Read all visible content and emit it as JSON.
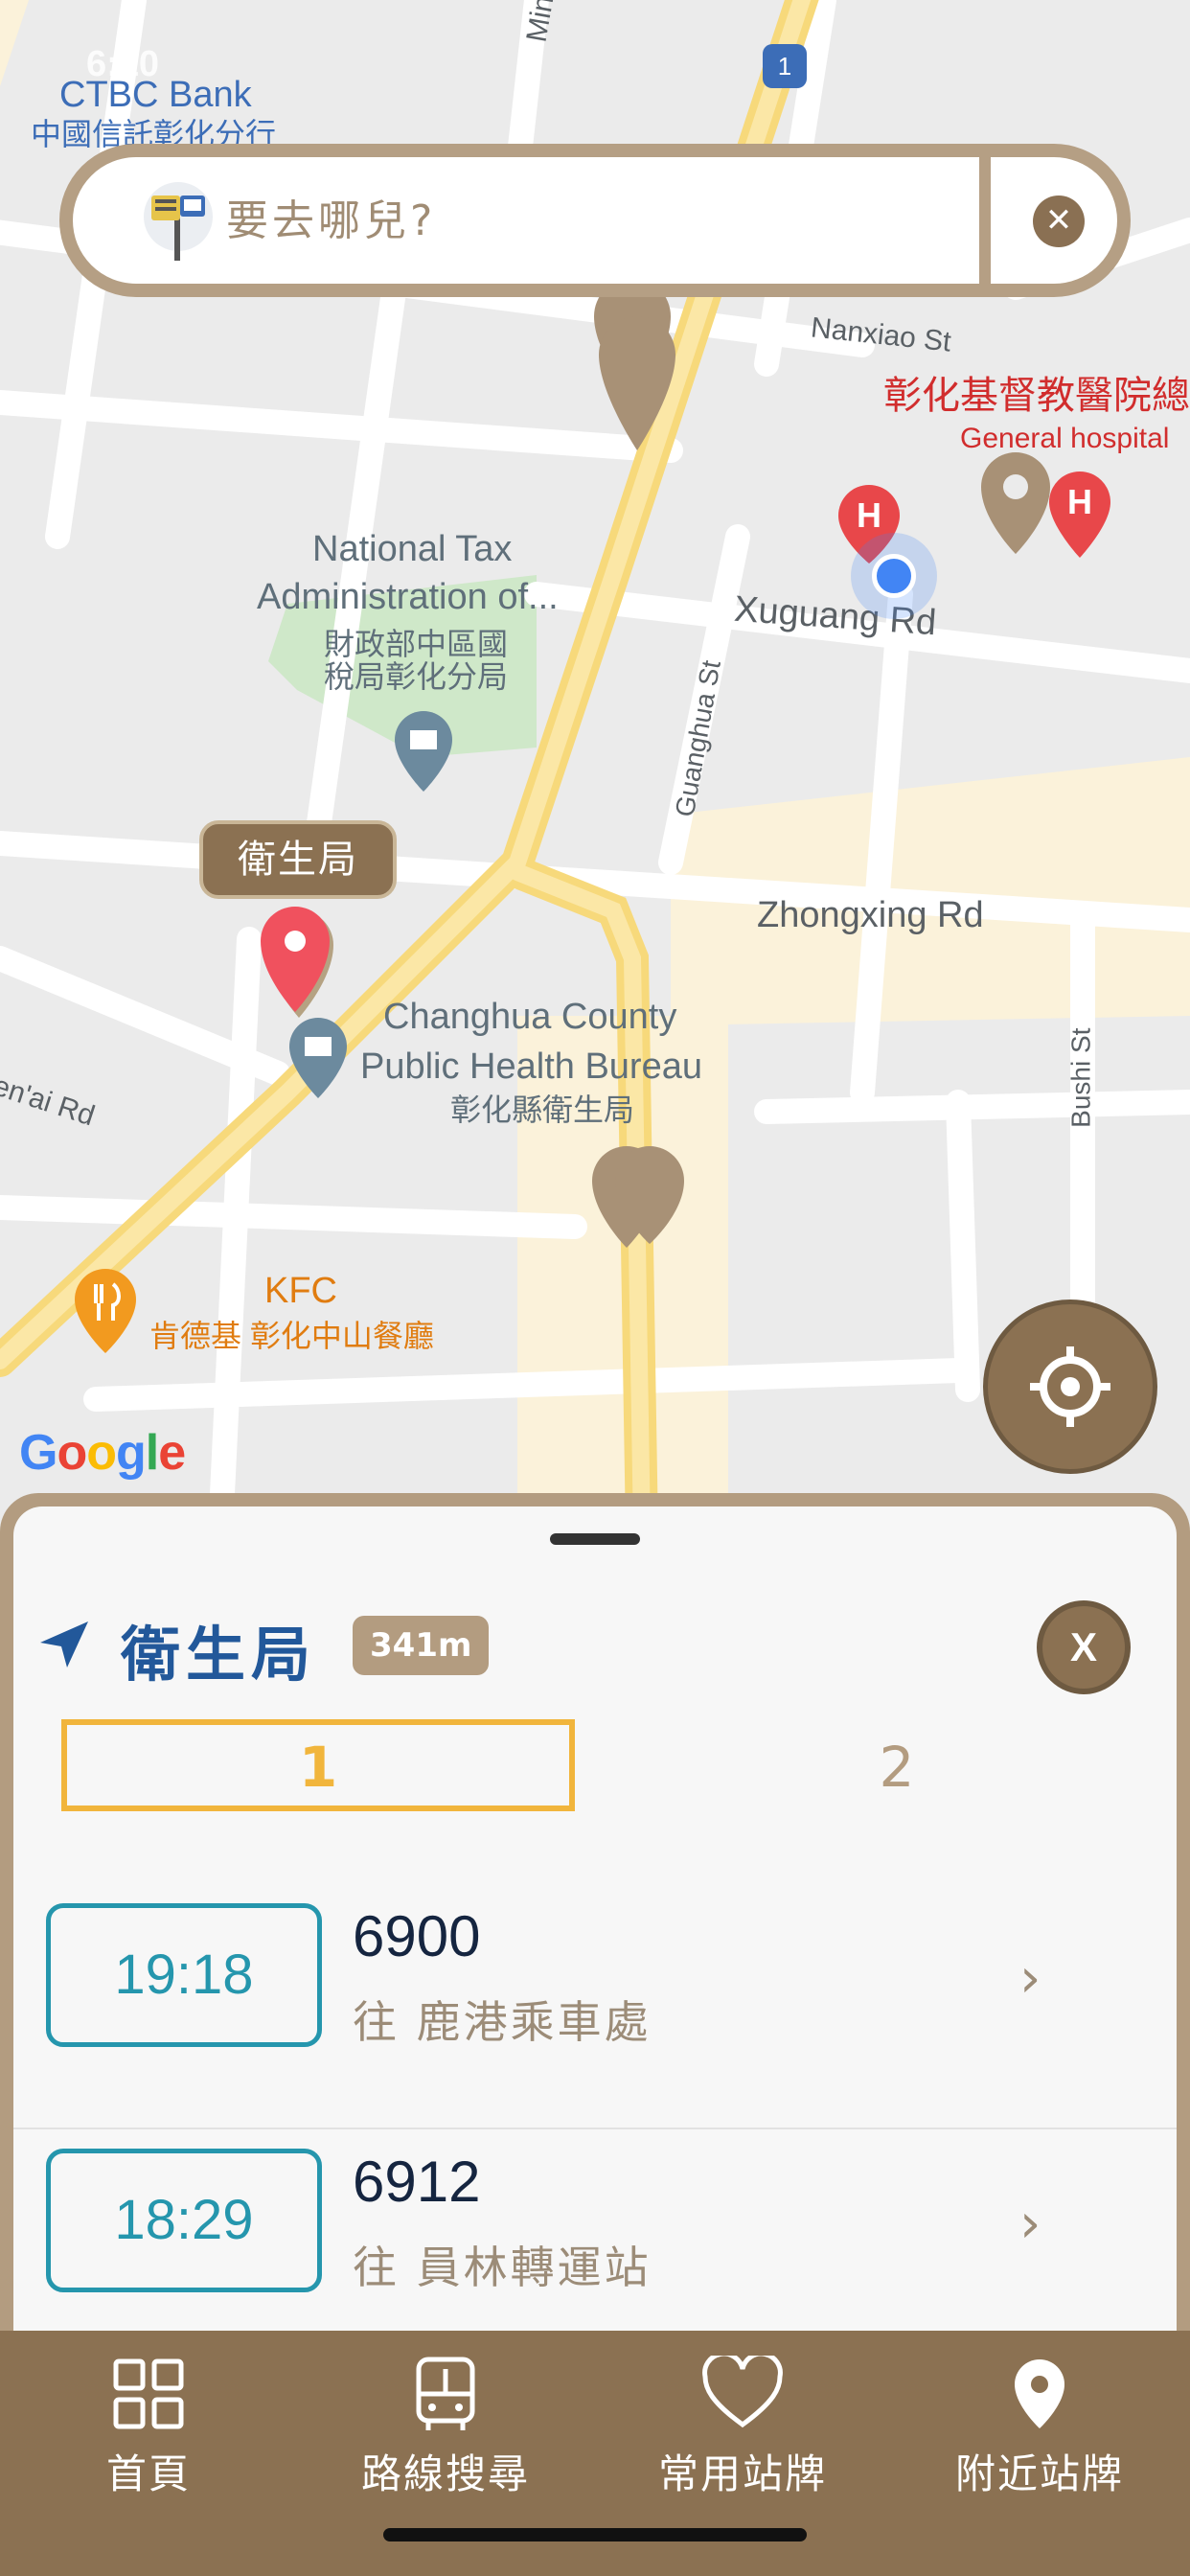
{
  "status_bar": {
    "time": "6:10"
  },
  "map": {
    "labels": {
      "ctbc_bank": "CTBC Bank",
      "ctbc_branch": "中國信託彰化分行",
      "road_min": "Min",
      "highway_shield": "1",
      "nanxiao_st": "Nanxiao St",
      "hospital_zh": "彰化基督教醫院總",
      "hospital_en": "General hospital",
      "tax_admin_en_1": "National Tax",
      "tax_admin_en_2": "Administration of...",
      "tax_admin_zh_1": "財政部中區國",
      "tax_admin_zh_2": "稅局彰化分局",
      "xuguang_rd": "Xuguang Rd",
      "guanghua_st": "Guanghua St",
      "zhongxing_rd": "Zhongxing Rd",
      "health_bureau_en_1": "Changhua County",
      "health_bureau_en_2": "Public Health Bureau",
      "health_bureau_zh": "彰化縣衛生局",
      "renai_rd": "Ren'ai Rd",
      "bushi_st": "Bushi St",
      "kfc_en": "KFC",
      "kfc_zh": "肯德基 彰化中山餐廳",
      "google": "Google"
    },
    "selected_stop_tag": "衛生局"
  },
  "search": {
    "placeholder": "要去哪兒?",
    "value": ""
  },
  "sheet": {
    "stop_name": "衛生局",
    "distance": "341m",
    "close_label": "X",
    "tabs": [
      {
        "label": "1",
        "active": true
      },
      {
        "label": "2",
        "active": false
      }
    ],
    "routes": [
      {
        "time": "19:18",
        "number": "6900",
        "destination": "往 鹿港乘車處"
      },
      {
        "time": "18:29",
        "number": "6912",
        "destination": "往 員林轉運站"
      }
    ],
    "chevron": "›"
  },
  "tab_bar": {
    "items": [
      {
        "label": "首頁",
        "icon": "grid-icon"
      },
      {
        "label": "路線搜尋",
        "icon": "bus-icon"
      },
      {
        "label": "常用站牌",
        "icon": "heart-icon"
      },
      {
        "label": "附近站牌",
        "icon": "location-pin-icon"
      }
    ]
  },
  "colors": {
    "brand_brown": "#8b7152",
    "brand_tan": "#b39c80",
    "accent_yellow": "#f1b53c",
    "time_teal": "#2596ad",
    "title_blue": "#22589a"
  }
}
